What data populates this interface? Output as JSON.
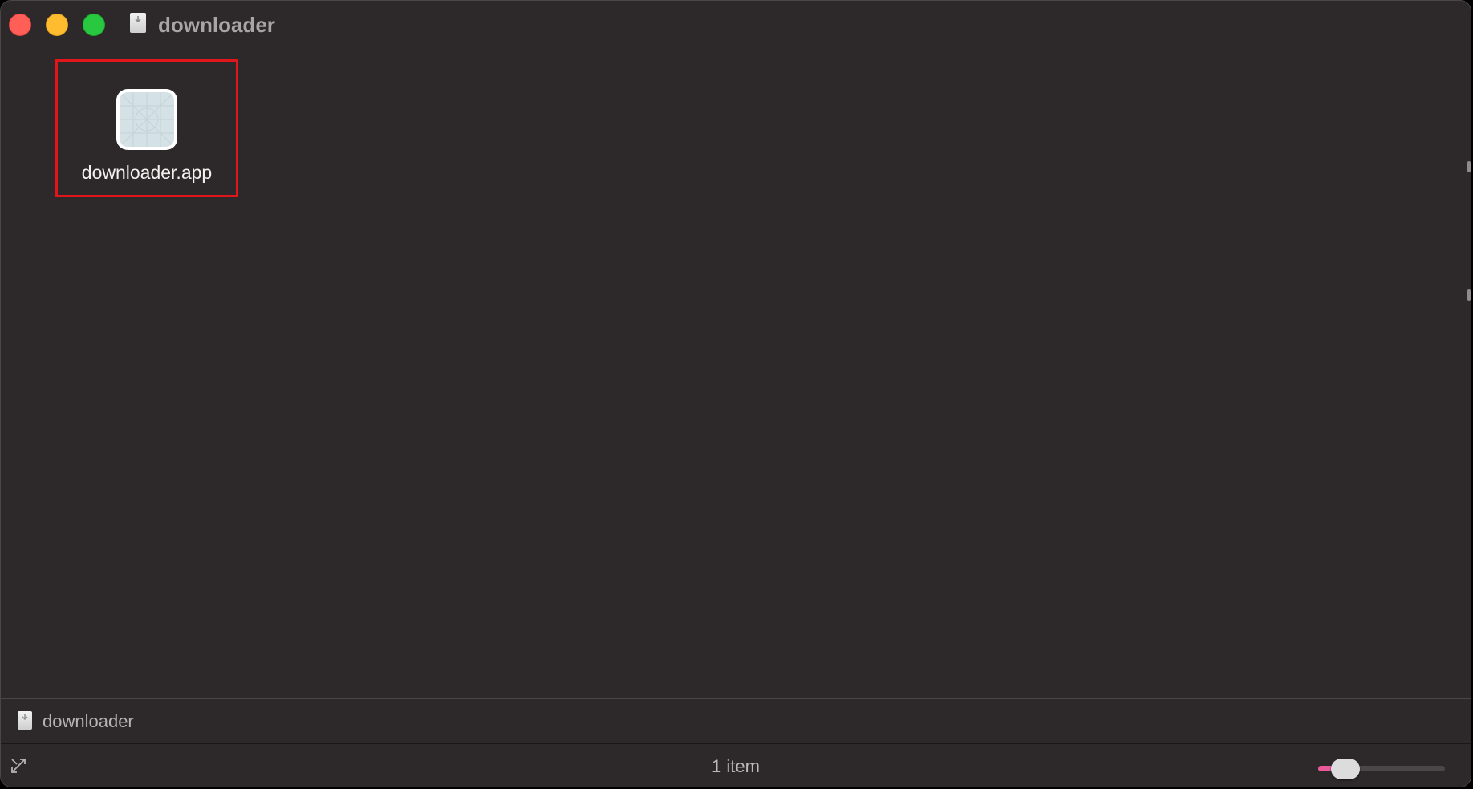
{
  "window": {
    "title": "downloader"
  },
  "titlebar": {
    "buttons": [
      {
        "name": "close",
        "color": "#ff5f57"
      },
      {
        "name": "minimize",
        "color": "#febc2e"
      },
      {
        "name": "zoom",
        "color": "#28c840"
      }
    ],
    "folder_icon": "disk-image-icon"
  },
  "content": {
    "items": [
      {
        "label": "downloader.app",
        "icon": "app-icon",
        "selected_highlight": "#e0161b"
      }
    ]
  },
  "pathbar": {
    "icon": "disk-image-icon",
    "label": "downloader"
  },
  "statusbar": {
    "item_count": "1 item",
    "icon_size_slider": {
      "value_fraction": 0.14,
      "accent": "#ea5a9a"
    }
  }
}
